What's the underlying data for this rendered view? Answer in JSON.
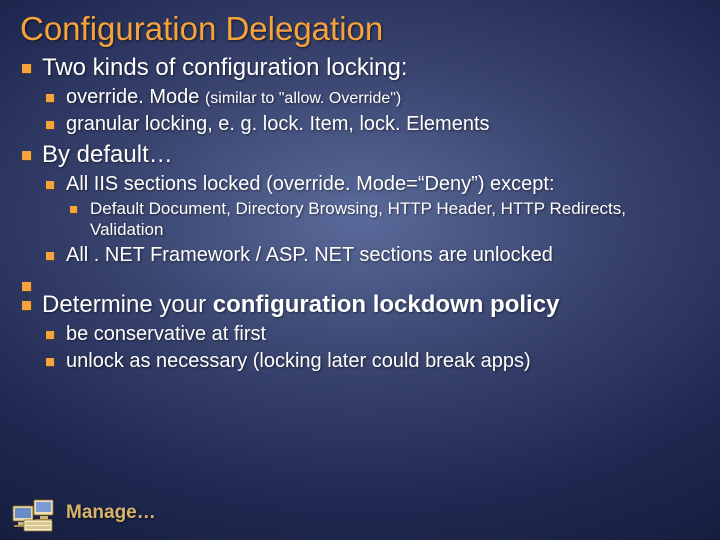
{
  "title": "Configuration Delegation",
  "bullets": {
    "b1": "Two kinds of configuration locking:",
    "b1a": "override. Mode ",
    "b1a_note": "(similar to \"allow. Override\")",
    "b1b": "granular locking, e. g. lock. Item, lock. Elements",
    "b2": "By default…",
    "b2a": "All IIS sections locked (override. Mode=“Deny”) except:",
    "b2a1": "Default Document, Directory Browsing, HTTP Header, HTTP Redirects, Validation",
    "b2b": "All . NET Framework / ASP. NET sections are unlocked",
    "b3_pre": "Determine your ",
    "b3_bold": "configuration lockdown policy",
    "b3a": "be conservative at first",
    "b3b": "unlock as necessary (locking later could break apps)"
  },
  "footer": "Manage…"
}
